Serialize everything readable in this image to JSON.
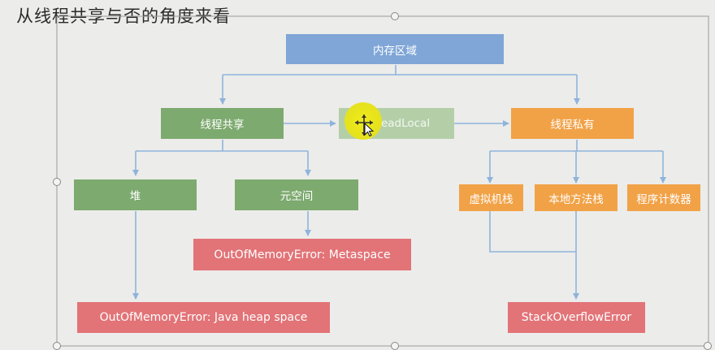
{
  "slide": {
    "title": "从线程共享与否的角度来看"
  },
  "diagram": {
    "root": "内存区域",
    "shared": "线程共享",
    "threadlocal": "ThreadLocal",
    "private": "线程私有",
    "heap": "堆",
    "metaspace": "元空间",
    "vm_stack": "虚拟机栈",
    "native_stack": "本地方法栈",
    "pc_register": "程序计数器",
    "oom_metaspace": "OutOfMemoryError: Metaspace",
    "oom_heap": "OutOfMemoryError: Java heap space",
    "stack_overflow": "StackOverflowError"
  },
  "colors": {
    "root": "#7fa6d6",
    "shared": "#7daa6f",
    "private": "#f1a247",
    "error": "#e27377",
    "connector": "#8fb4dc"
  }
}
